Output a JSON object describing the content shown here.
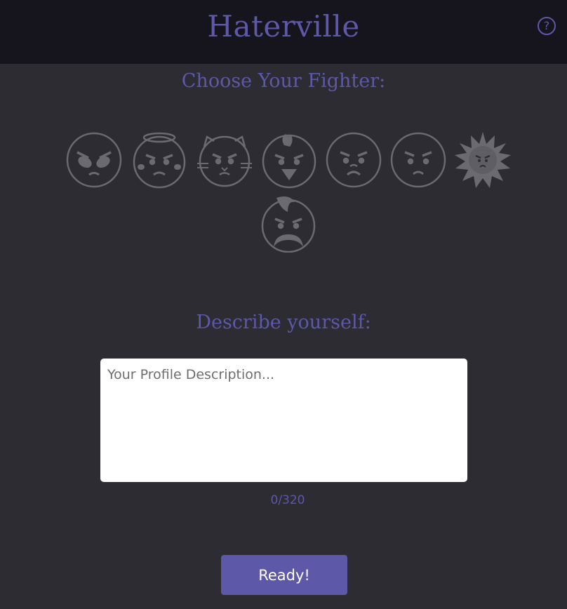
{
  "header": {
    "title": "Haterville",
    "help_label": "?"
  },
  "fighter_section": {
    "title": "Choose Your Fighter:",
    "fighters": [
      "alien",
      "angel",
      "cat",
      "chick",
      "snout",
      "plain",
      "sun",
      "mustache"
    ]
  },
  "profile": {
    "title": "Describe yourself:",
    "placeholder": "Your Profile Description...",
    "value": "",
    "counter": "0/320"
  },
  "actions": {
    "ready_label": "Ready!"
  },
  "colors": {
    "accent": "#5d58a8",
    "header_bg": "#16141d",
    "page_bg": "#2d2c33",
    "icon_stroke": "#6b6a70"
  }
}
